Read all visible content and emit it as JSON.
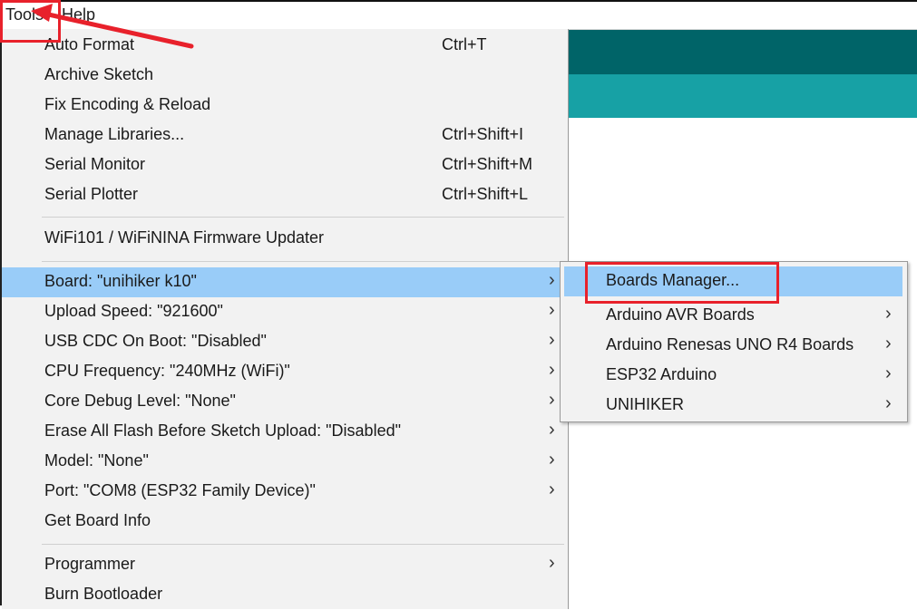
{
  "menubar": {
    "tools": "Tools",
    "help": "Help"
  },
  "tools_menu": {
    "items": [
      {
        "label": "Auto Format",
        "shortcut": "Ctrl+T"
      },
      {
        "label": "Archive Sketch",
        "shortcut": ""
      },
      {
        "label": "Fix Encoding & Reload",
        "shortcut": ""
      },
      {
        "label": "Manage Libraries...",
        "shortcut": "Ctrl+Shift+I"
      },
      {
        "label": "Serial Monitor",
        "shortcut": "Ctrl+Shift+M"
      },
      {
        "label": "Serial Plotter",
        "shortcut": "Ctrl+Shift+L"
      },
      {
        "label": "WiFi101 / WiFiNINA Firmware Updater",
        "shortcut": ""
      },
      {
        "label": "Board: \"unihiker k10\"",
        "submenu_arrow": "›"
      },
      {
        "label": "Upload Speed: \"921600\"",
        "submenu_arrow": "›"
      },
      {
        "label": "USB CDC On Boot: \"Disabled\"",
        "submenu_arrow": "›"
      },
      {
        "label": "CPU Frequency: \"240MHz (WiFi)\"",
        "submenu_arrow": "›"
      },
      {
        "label": "Core Debug Level: \"None\"",
        "submenu_arrow": "›"
      },
      {
        "label": "Erase All Flash Before Sketch Upload: \"Disabled\"",
        "submenu_arrow": "›"
      },
      {
        "label": "Model: \"None\"",
        "submenu_arrow": "›"
      },
      {
        "label": "Port: \"COM8 (ESP32 Family Device)\"",
        "submenu_arrow": "›"
      },
      {
        "label": "Get Board Info"
      },
      {
        "label": "Programmer",
        "submenu_arrow": "›"
      },
      {
        "label": "Burn Bootloader"
      }
    ],
    "highlighted_item": "Board: \"unihiker k10\""
  },
  "board_submenu": {
    "items": [
      {
        "label": "Boards Manager..."
      },
      {
        "label": "Arduino AVR Boards",
        "submenu_arrow": "›"
      },
      {
        "label": "Arduino Renesas UNO R4 Boards",
        "submenu_arrow": "›"
      },
      {
        "label": "ESP32 Arduino",
        "submenu_arrow": "›"
      },
      {
        "label": "UNIHIKER",
        "submenu_arrow": "›"
      }
    ],
    "highlighted_item": "Boards Manager..."
  },
  "annotations": {
    "highlight_color": "#e8212b",
    "boxed_items": [
      "Tools",
      "Boards Manager..."
    ],
    "arrow_points_to": "Tools"
  },
  "colors": {
    "menu_background": "#f2f2f2",
    "menu_highlight": "#99ccf8",
    "editor_header_dark": "#006468",
    "editor_header_light": "#17a1a5"
  }
}
